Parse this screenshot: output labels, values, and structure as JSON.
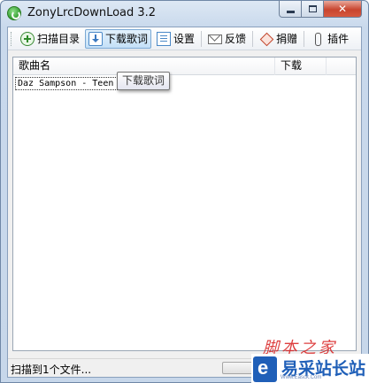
{
  "window": {
    "title": "ZonyLrcDownLoad 3.2",
    "close_glyph": "✕"
  },
  "toolbar": {
    "items": [
      {
        "label": "扫描目录",
        "icon": "scan-folder-icon"
      },
      {
        "label": "下载歌词",
        "icon": "download-lyrics-icon",
        "active": true
      },
      {
        "label": "设置",
        "icon": "settings-icon"
      },
      {
        "label": "反馈",
        "icon": "feedback-mail-icon"
      },
      {
        "label": "捐赠",
        "icon": "donate-tag-icon"
      },
      {
        "label": "插件",
        "icon": "plugin-clip-icon"
      }
    ]
  },
  "list": {
    "columns": [
      "歌曲名",
      "下载"
    ],
    "rows": [
      {
        "song": "Daz Sampson - Teen",
        "download": ""
      }
    ]
  },
  "tooltip": "下载歌词",
  "status": {
    "text": "扫描到1个文件...",
    "progress": 0.0
  },
  "watermark": {
    "script_text": "脚本之家",
    "site_name": "易采站长站",
    "site_url": "Www.Easck.Com"
  },
  "colors": {
    "accent": "#7aa8d4",
    "close_button": "#c8452f",
    "watermark_blue": "#1f5fb8",
    "watermark_red": "#d81e1e"
  }
}
